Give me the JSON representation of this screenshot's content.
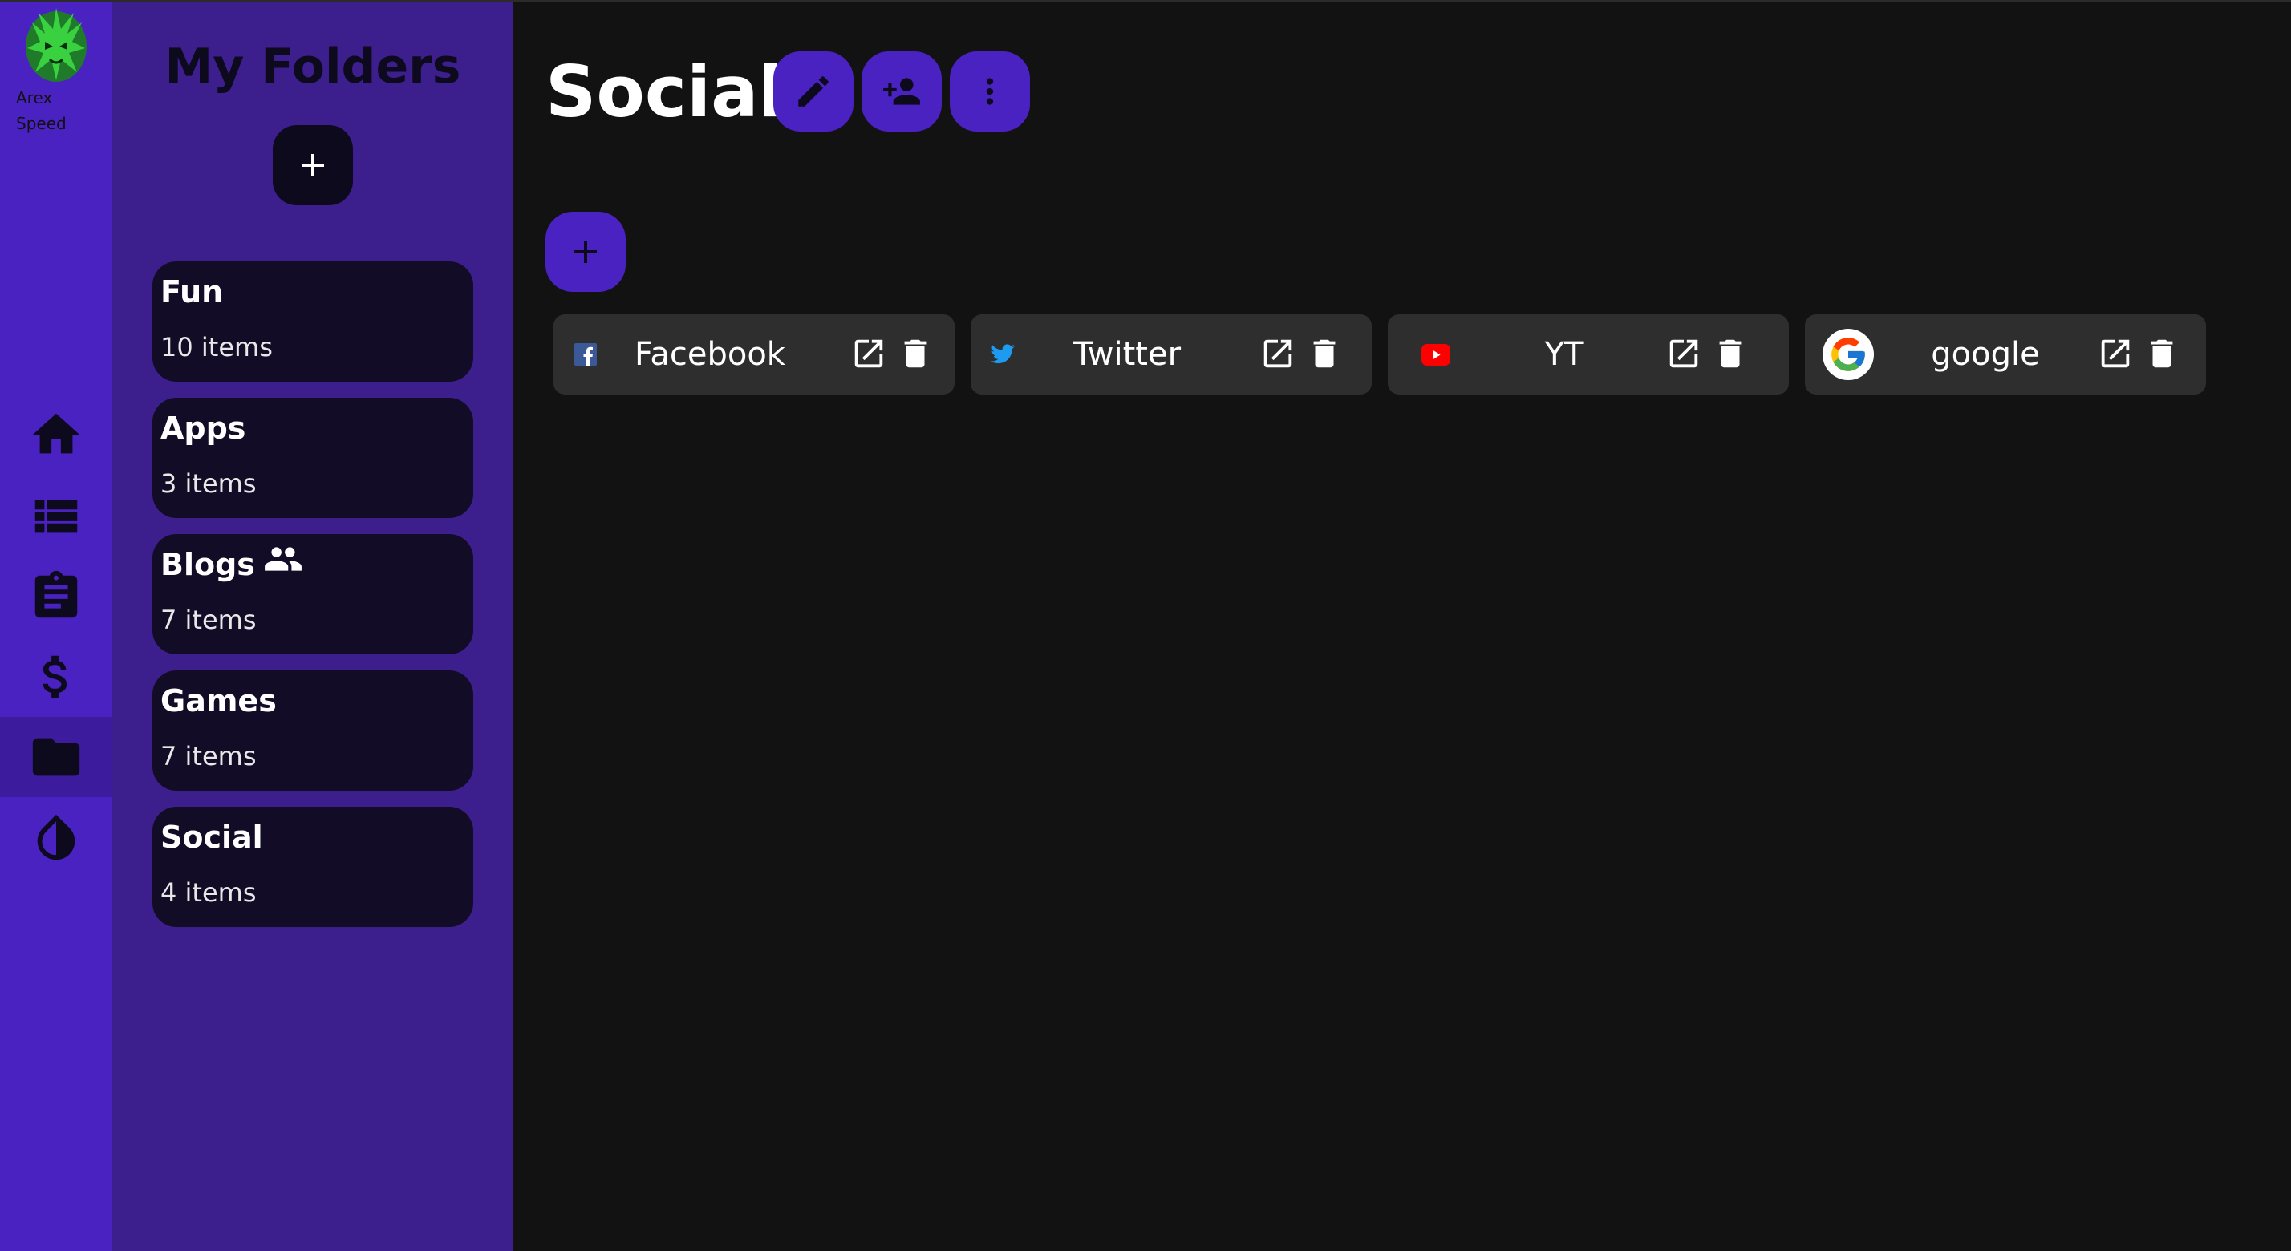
{
  "user": {
    "name": "Arex\nSpeed"
  },
  "folders_panel": {
    "title": "My Folders",
    "folders": [
      {
        "name": "Fun",
        "count": "10 items",
        "shared": false
      },
      {
        "name": "Apps",
        "count": "3 items",
        "shared": false
      },
      {
        "name": "Blogs",
        "count": "7 items",
        "shared": true
      },
      {
        "name": "Games",
        "count": "7 items",
        "shared": false
      },
      {
        "name": "Social",
        "count": "4 items",
        "shared": false
      }
    ]
  },
  "nav": {
    "items": [
      "home-icon",
      "list-icon",
      "clipboard-icon",
      "dollar-icon",
      "folder-icon",
      "contrast-icon"
    ],
    "active": "folder-icon"
  },
  "main": {
    "title": "Social",
    "links": [
      {
        "title": "Facebook",
        "icon": "facebook-icon"
      },
      {
        "title": "Twitter",
        "icon": "twitter-icon"
      },
      {
        "title": "YT",
        "icon": "youtube-icon"
      },
      {
        "title": "google",
        "icon": "google-icon"
      }
    ]
  },
  "colors": {
    "accent": "#4a22c2",
    "panel": "#3c1f8c",
    "card": "#120c26",
    "background": "#121212",
    "link_card": "#2e2e2e"
  }
}
